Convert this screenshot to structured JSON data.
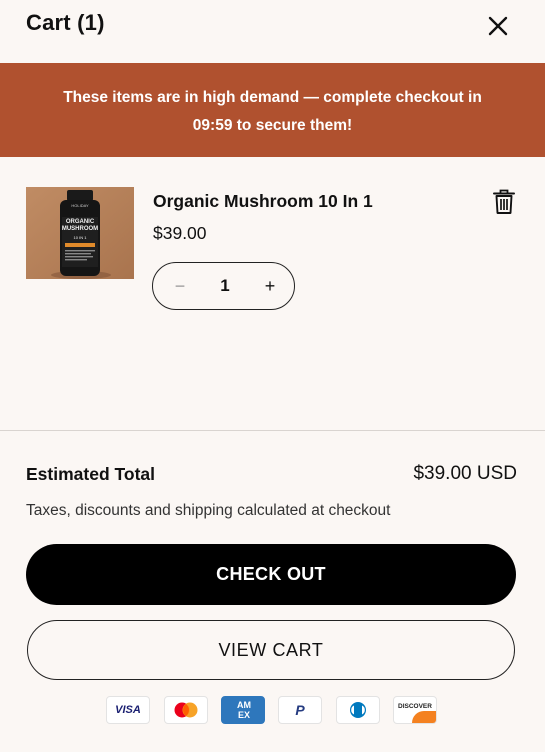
{
  "header": {
    "title": "Cart (1)",
    "close_icon": "close-icon"
  },
  "banner": {
    "line1": "These items are in high demand — complete checkout in",
    "timer": "09:59",
    "line2_rest": " to secure them!"
  },
  "item": {
    "name": "Organic Mushroom 10 In 1",
    "price": "$39.00",
    "quantity": "1",
    "minus": "−",
    "plus": "+",
    "image": {
      "brand": "HOLIDAY",
      "label_line1": "ORGANIC",
      "label_line2": "MUSHROOM",
      "label_line3": "10 IN 1"
    },
    "delete_icon": "trash-icon"
  },
  "summary": {
    "label": "Estimated Total",
    "value": "$39.00 USD",
    "note": "Taxes, discounts and shipping calculated at checkout"
  },
  "buttons": {
    "checkout": "CHECK OUT",
    "view_cart": "VIEW CART"
  },
  "payments": {
    "visa": "VISA",
    "mastercard": "mastercard-icon",
    "amex": "AM EX",
    "paypal": "P",
    "diners": "diners-icon",
    "discover": "DISCOVER"
  },
  "colors": {
    "banner": "#b0512f",
    "background": "#fbf7f4",
    "checkout": "#000000"
  }
}
